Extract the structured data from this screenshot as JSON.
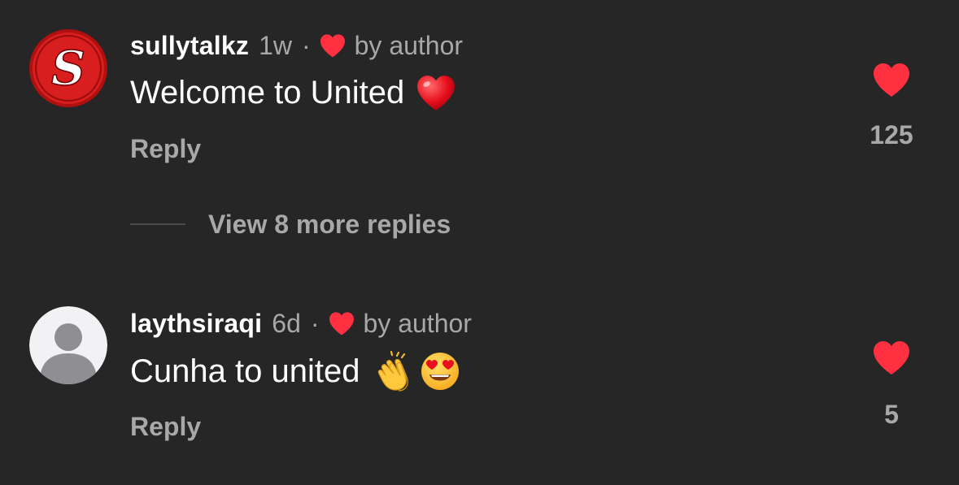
{
  "comments": [
    {
      "username": "sullytalkz",
      "time": "1w",
      "separator": "·",
      "liked_by_author": "by author",
      "text": "Welcome to United",
      "emojis": [
        "red-heart-emoji"
      ],
      "reply_label": "Reply",
      "like_count": "125",
      "avatar": "red-s-logo-avatar"
    },
    {
      "username": "laythsiraqi",
      "time": "6d",
      "separator": "·",
      "liked_by_author": "by author",
      "text": "Cunha to united",
      "emojis": [
        "clapping-hands-emoji",
        "heart-eyes-emoji"
      ],
      "reply_label": "Reply",
      "like_count": "5",
      "avatar": "default-user-avatar"
    }
  ],
  "view_replies": {
    "label": "View 8 more replies"
  },
  "colors": {
    "background": "#262626",
    "heart": "#ff3040",
    "muted_text": "#a8a8a8",
    "primary_text": "#ffffff"
  }
}
